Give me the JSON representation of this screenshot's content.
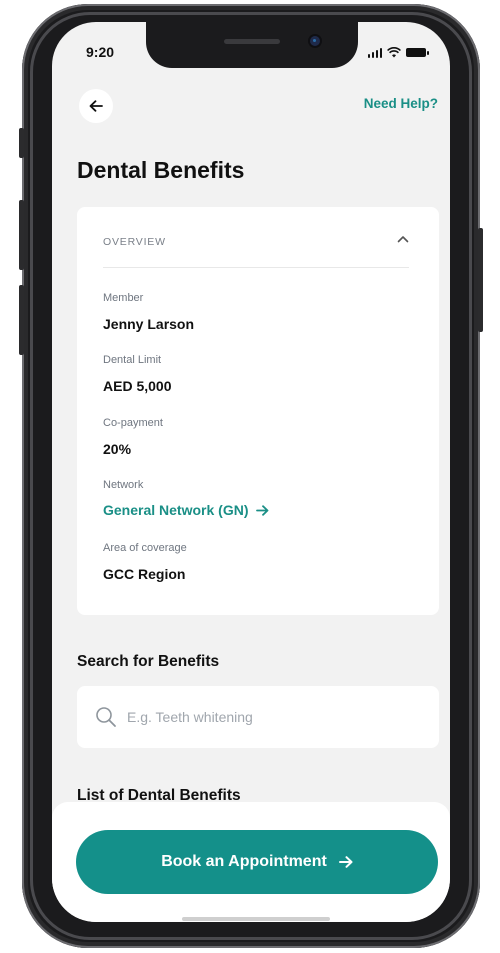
{
  "status_bar": {
    "time": "9:20"
  },
  "header": {
    "back_icon": "arrow-left-icon",
    "help_label": "Need Help?",
    "title": "Dental Benefits"
  },
  "overview": {
    "section_label": "OVERVIEW",
    "collapse_icon": "chevron-up-icon",
    "fields": [
      {
        "label": "Member",
        "value": "Jenny Larson"
      },
      {
        "label": "Dental Limit",
        "value": "AED 5,000"
      },
      {
        "label": "Co-payment",
        "value": "20%"
      },
      {
        "label": "Network",
        "value": "General Network (GN)"
      },
      {
        "label": "Area of coverage",
        "value": "GCC Region"
      }
    ]
  },
  "search": {
    "title": "Search for Benefits",
    "placeholder": "E.g. Teeth whitening",
    "value": ""
  },
  "benefits_list": {
    "title": "List of Dental Benefits"
  },
  "cta": {
    "label": "Book an Appointment"
  },
  "colors": {
    "accent": "#14908a",
    "link": "#1a8f86",
    "screen_bg": "#f2f2f2",
    "card_bg": "#ffffff"
  }
}
